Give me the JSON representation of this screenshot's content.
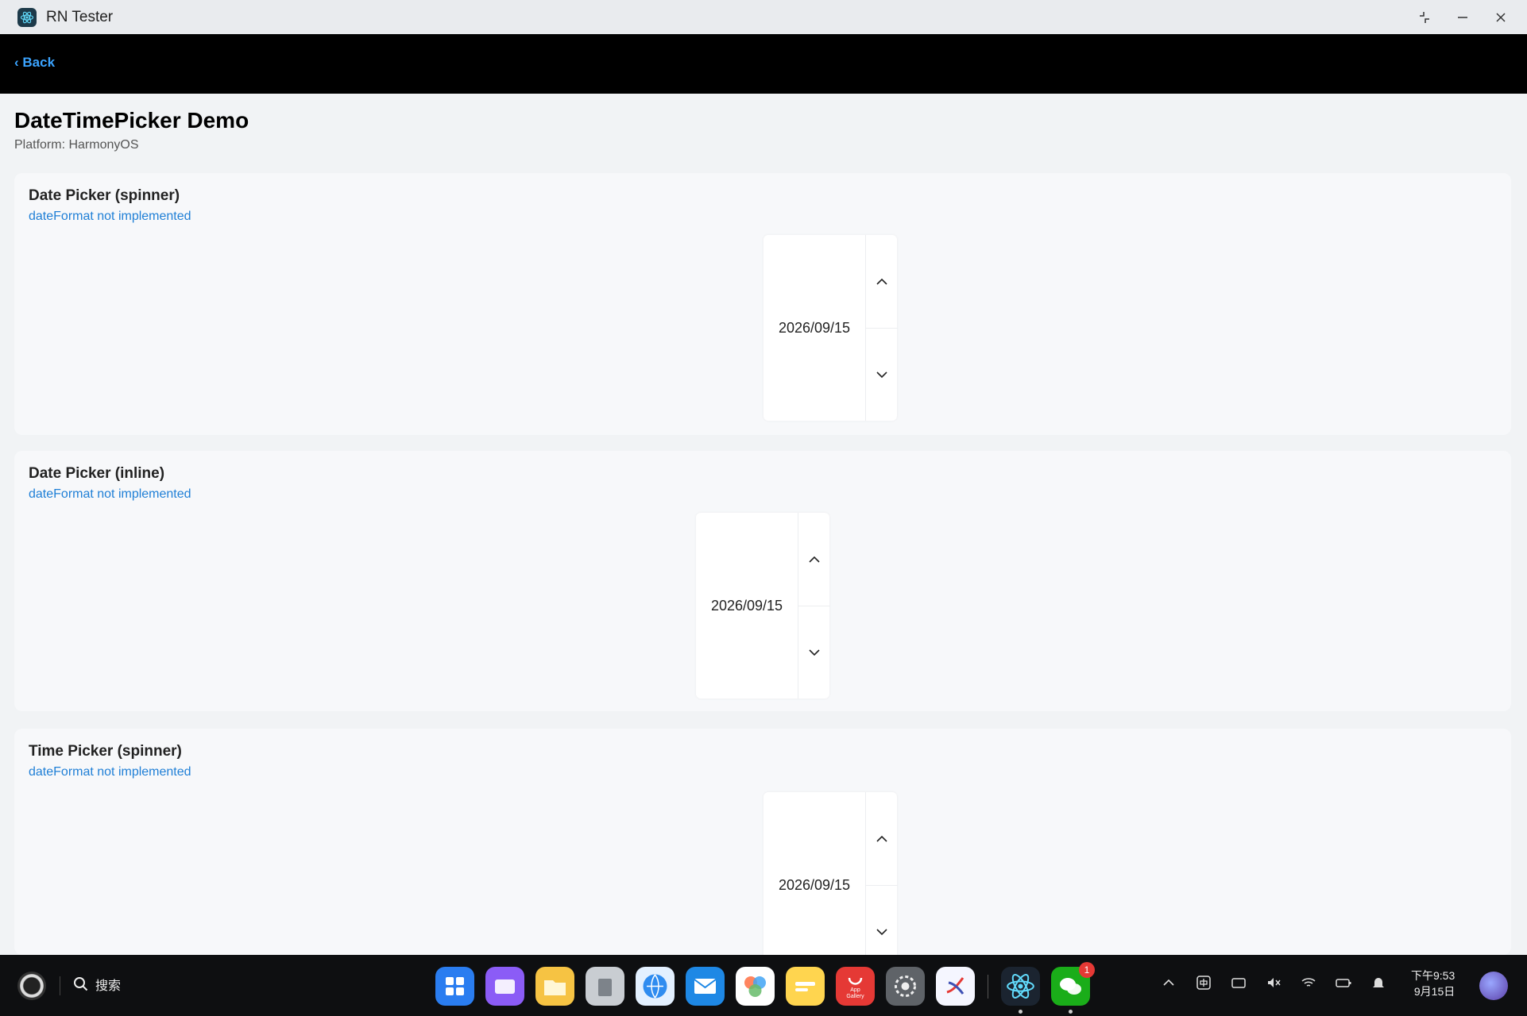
{
  "window": {
    "title": "RN Tester"
  },
  "nav": {
    "back_label": "‹ Back"
  },
  "page": {
    "title": "DateTimePicker Demo",
    "platform": "Platform: HarmonyOS"
  },
  "sections": [
    {
      "title": "Date Picker (spinner)",
      "note": "dateFormat not implemented",
      "value": "2026/09/15"
    },
    {
      "title": "Date Picker (inline)",
      "note": "dateFormat not implemented",
      "value": "2026/09/15"
    },
    {
      "title": "Time Picker (spinner)",
      "note": "dateFormat not implemented",
      "value": "2026/09/15"
    }
  ],
  "taskbar": {
    "search_label": "搜索",
    "dock": [
      {
        "name": "app-center-icon",
        "color": "#2a7df0"
      },
      {
        "name": "multitask-icon",
        "color": "#8b5cf6"
      },
      {
        "name": "files-icon",
        "color": "#f6c343"
      },
      {
        "name": "trash-icon",
        "color": "#9aa0a6"
      },
      {
        "name": "browser-icon",
        "color": "#2f8cf0"
      },
      {
        "name": "mail-icon",
        "color": "#1e88e5"
      },
      {
        "name": "photos-icon",
        "color": "#ff7043"
      },
      {
        "name": "notes-icon",
        "color": "#ffd54f"
      },
      {
        "name": "app-gallery-icon",
        "color": "#e53935",
        "label": "App Gallery"
      },
      {
        "name": "settings-icon",
        "color": "#5f6368"
      },
      {
        "name": "editor-icon",
        "color": "#e8eaf6"
      },
      {
        "name": "react-icon",
        "color": "#1b2430"
      },
      {
        "name": "wechat-icon",
        "color": "#1aad19",
        "badge": "1"
      }
    ],
    "clock_time": "下午9:53",
    "clock_date": "9月15日"
  },
  "colors": {
    "accent": "#1f7fd6",
    "back_link": "#3ba4ff",
    "navbar": "#000000"
  }
}
